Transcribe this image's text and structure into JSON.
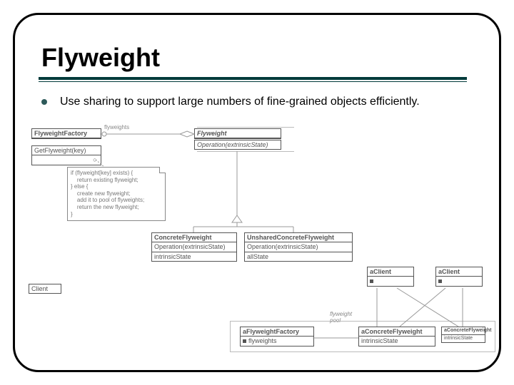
{
  "slide": {
    "title": "Flyweight",
    "bullet": "Use sharing to support large numbers of fine-grained objects efficiently."
  },
  "diagram": {
    "factory": {
      "name": "FlyweightFactory",
      "op": "GetFlyweight(key)"
    },
    "flyweight": {
      "name": "Flyweight",
      "op": "Operation(extrinsicState)"
    },
    "concrete": {
      "name": "ConcreteFlyweight",
      "op": "Operation(extrinsicState)",
      "state": "intrinsicState"
    },
    "unshared": {
      "name": "UnsharedConcreteFlyweight",
      "op": "Operation(extrinsicState)",
      "state": "allState"
    },
    "client": {
      "name": "Client"
    },
    "assoc_flyweights": "flyweights",
    "noteText": "if (flyweight[key] exists) {\n    return existing flyweight;\n} else {\n    create new flyweight;\n    add it to pool of flyweights;\n    return the new flyweight;\n}"
  },
  "collab": {
    "aClient1": "aClient",
    "aClient2": "aClient",
    "aFactory": {
      "name": "aFlyweightFactory",
      "state": "flyweights"
    },
    "aConcrete": {
      "name": "aConcreteFlyweight",
      "state": "intrinsicState"
    },
    "aConcrete2": {
      "name": "aConcreteFlyweight",
      "state": "intrinsicState"
    },
    "poolLabel": "flyweight\npool"
  }
}
